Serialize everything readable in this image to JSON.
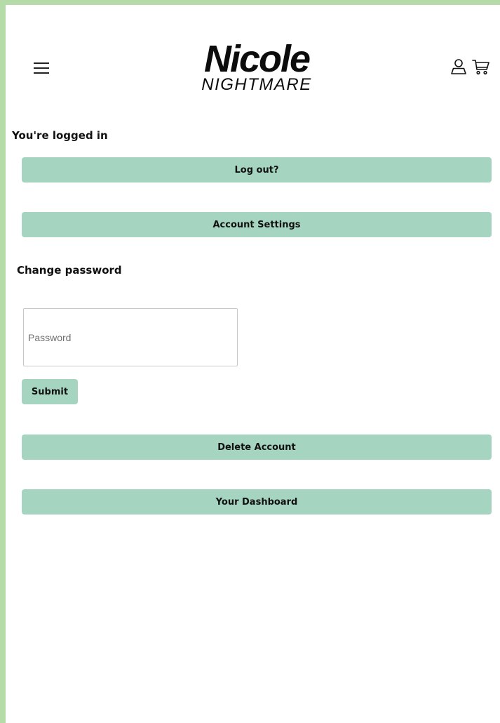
{
  "header": {
    "logo_top": "Nicole",
    "logo_bottom": "NIGHTMARE",
    "menu_icon": "hamburger-menu-icon",
    "account_icon": "user-icon",
    "cart_icon": "cart-icon"
  },
  "status": {
    "logged_in_text": "You're logged in"
  },
  "buttons": {
    "logout": "Log out?",
    "account_settings": "Account Settings",
    "submit": "Submit",
    "delete_account": "Delete Account",
    "dashboard": "Your Dashboard"
  },
  "change_password": {
    "heading": "Change password",
    "placeholder": "Password",
    "value": ""
  },
  "colors": {
    "frame": "#b5dba8",
    "button_bg": "#a5d5c1"
  }
}
